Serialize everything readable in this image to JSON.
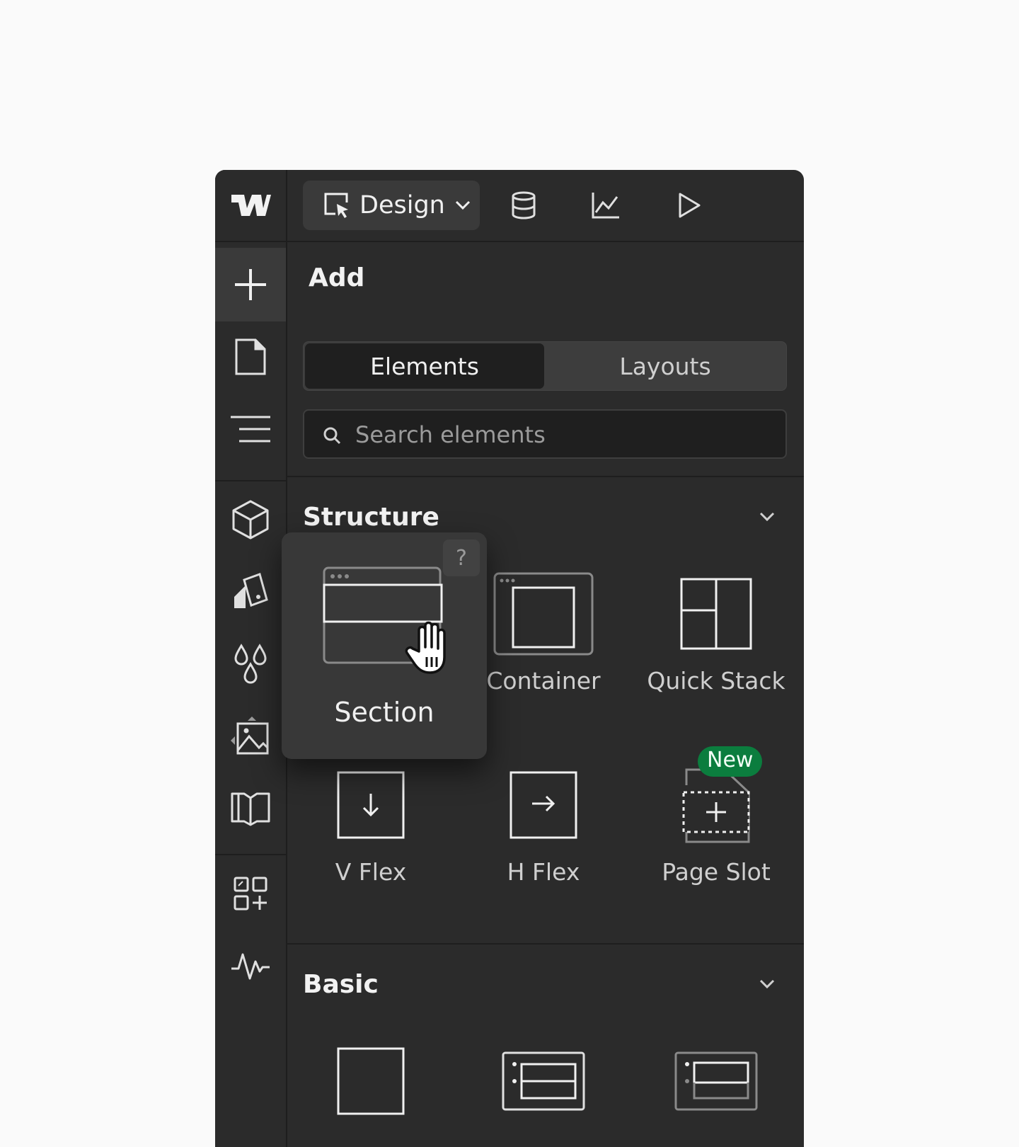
{
  "topbar": {
    "mode_label": "Design",
    "icons": [
      "cms-database-icon",
      "analyze-chart-icon",
      "preview-play-icon"
    ]
  },
  "rail": {
    "icons": [
      "add-plus-icon",
      "pages-icon",
      "navigator-icon",
      "components-cube-icon",
      "styles-icon",
      "variables-drops-icon",
      "assets-image-icon",
      "library-book-icon",
      "apps-icon",
      "audit-pulse-icon"
    ]
  },
  "panel": {
    "title": "Add",
    "tabs": {
      "elements": "Elements",
      "layouts": "Layouts"
    },
    "search_placeholder": "Search elements"
  },
  "structure": {
    "heading": "Structure",
    "items": [
      "Section",
      "Container",
      "Quick Stack",
      "V Flex",
      "H Flex",
      "Page Slot"
    ],
    "new_badge": "New"
  },
  "popup": {
    "help": "?",
    "label": "Section"
  },
  "basic": {
    "heading": "Basic"
  },
  "colors": {
    "panel_bg": "#2b2b2b",
    "badge_green": "#0b7d3e"
  }
}
